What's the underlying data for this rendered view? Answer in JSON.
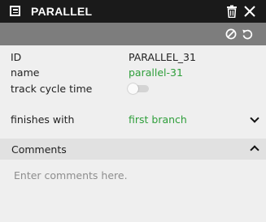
{
  "panel": {
    "title": "PARALLEL",
    "title_icon": "element-list-icon",
    "actions": {
      "delete": "trash-icon",
      "close": "close-icon"
    },
    "toolbar": {
      "disable": "circle-slash-icon",
      "reset": "undo-icon"
    }
  },
  "properties": {
    "id": {
      "label": "ID",
      "value": "PARALLEL_31"
    },
    "name": {
      "label": "name",
      "value": "parallel-31"
    },
    "track_cycle_time": {
      "label": "track cycle time",
      "checked": false
    },
    "finishes_with": {
      "label": "finishes with",
      "value": "first branch",
      "icon": "chevron-down-icon"
    }
  },
  "comments": {
    "title": "Comments",
    "expanded": true,
    "icon": "chevron-up-icon",
    "placeholder": "Enter comments here.",
    "value": ""
  },
  "colors": {
    "title_bar": "#1a1a1a",
    "toolbar": "#7d7d7d",
    "panel_bg": "#efefef",
    "section_header": "#e1e1e1",
    "accent_green": "#2e9e3a"
  }
}
